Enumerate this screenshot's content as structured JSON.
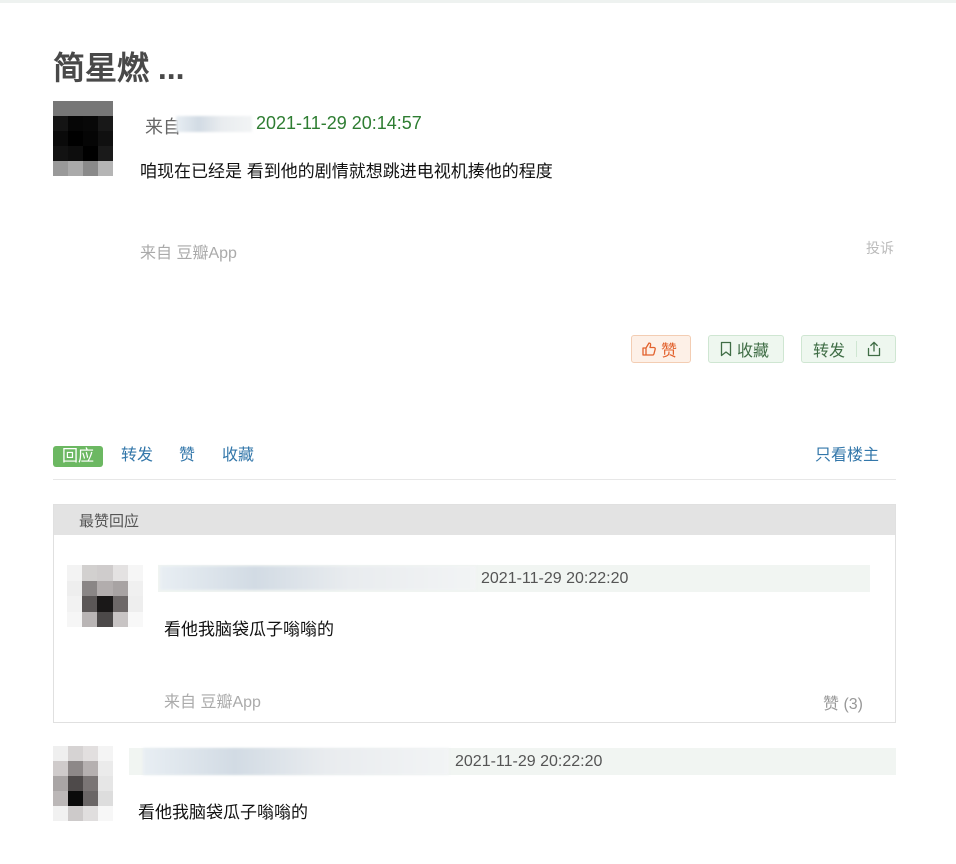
{
  "post": {
    "title": "简星燃 ...",
    "from_label": "来自",
    "timestamp": "2021-11-29 20:14:57",
    "content": "咱现在已经是 看到他的剧情就想跳进电视机揍他的程度",
    "via": "来自 豆瓣App",
    "report": "投诉",
    "like_label": "赞",
    "fav_label": "收藏",
    "share_label": "转发"
  },
  "tabs": {
    "reply": "回应",
    "share": "转发",
    "like": "赞",
    "fav": "收藏",
    "op_only": "只看楼主"
  },
  "best_replies": {
    "header": "最赞回应",
    "items": [
      {
        "time": "2021-11-29 20:22:20",
        "text": "看他我脑袋瓜子嗡嗡的",
        "via": "来自 豆瓣App",
        "likes": "赞 (3)"
      }
    ]
  },
  "replies": [
    {
      "time": "2021-11-29 20:22:20",
      "text": "看他我脑袋瓜子嗡嗡的"
    }
  ],
  "colors": {
    "timestamp_green": "#2e7d32",
    "link_blue": "#3377aa",
    "active_tab_green": "#6cb862",
    "like_orange": "#e2612c"
  },
  "icons": [
    "thumb-up-icon",
    "bookmark-icon",
    "share-icon"
  ]
}
